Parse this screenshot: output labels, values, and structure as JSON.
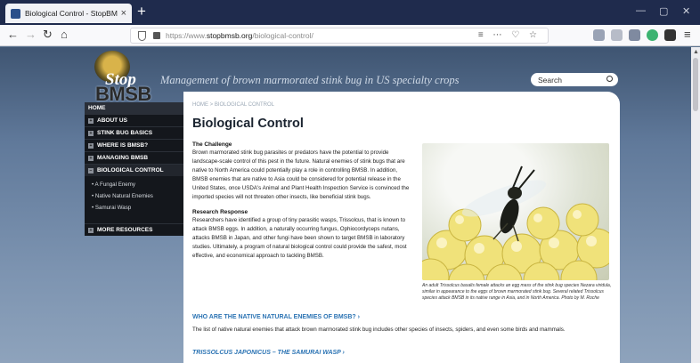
{
  "browser": {
    "tab_title": "Biological Control - StopBMSB",
    "new_tab": "+",
    "url_prefix": "https://www.",
    "url_domain": "stopbmsb.org",
    "url_path": "/biological-control/",
    "url_actions": "≡ ⋯ ♡ ☆"
  },
  "site": {
    "logo_stop": "Stop",
    "logo_bmsb": "BMSB",
    "tagline": "Management of brown marmorated stink bug in US specialty crops",
    "search_placeholder": "Search"
  },
  "sidebar": {
    "home": "HOME",
    "items": [
      {
        "label": "ABOUT US",
        "marker": "+"
      },
      {
        "label": "STINK BUG BASICS",
        "marker": "+"
      },
      {
        "label": "WHERE IS BMSB?",
        "marker": "+"
      },
      {
        "label": "MANAGING BMSB",
        "marker": "+"
      },
      {
        "label": "BIOLOGICAL CONTROL",
        "marker": "−"
      }
    ],
    "sub_items": [
      "A Fungal Enemy",
      "Native Natural Enemies",
      "Samurai Wasp"
    ],
    "more": {
      "label": "MORE RESOURCES",
      "marker": "+"
    }
  },
  "content": {
    "breadcrumb": "HOME > BIOLOGICAL CONTROL",
    "title": "Biological Control",
    "challenge_heading": "The Challenge",
    "challenge_text": "Brown marmorated stink bug parasites or predators have the potential to provide landscape-scale control of this pest in the future. Natural enemies of stink bugs that are native to North America could potentially play a role in controlling BMSB. In addition, BMSB enemies that are native to Asia could be considered for potential release in the United States, once USDA's Animal and Plant Health Inspection Service is convinced the imported species will not threaten other insects, like beneficial stink bugs.",
    "research_heading": "Research Response",
    "research_text": "Researchers have identified a group of tiny parasitic wasps, Trissolcus, that is known to attack BMSB eggs. In addition, a naturally occurring fungus, Ophiocordyceps nutans, attacks BMSB in Japan, and other fungi have been shown to target BMSB in laboratory studies. Ultimately, a program of natural biological control could provide the safest, most effective, and economical approach to tackling BMSB.",
    "caption": "An adult Trissolcus basalis female attacks an egg mass of the stink bug species Nezara viridula, similar in appearance to the eggs of brown marmorated stink bug. Several related Trissolcus species attack BMSB in its native range in Asia, and in North America. Photo by M. Roche",
    "native_link": "WHO ARE THE NATIVE NATURAL ENEMIES OF BMSB? ›",
    "native_text": "The list of native natural enemies that attack brown marmorated stink bug includes other species of insects, spiders, and even some birds and mammals.",
    "samurai_link": "TRISSOLCUS JAPONICUS – THE SAMURAI WASP ›"
  },
  "colors": {
    "link": "#2c74b4",
    "nav_bg": "#14171c",
    "tab_strip": "#1f2b4d"
  }
}
